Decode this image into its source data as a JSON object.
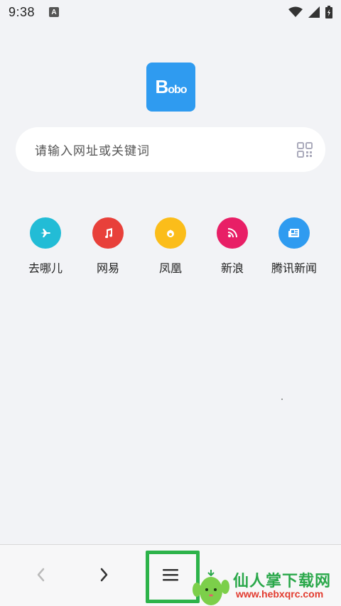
{
  "status_bar": {
    "time": "9:38",
    "notification_icon": "a-icon",
    "wifi_icon": "wifi-icon",
    "signal_icon": "signal-icon",
    "battery_icon": "battery-charging-icon"
  },
  "logo": {
    "text_main": "B",
    "text_rest": "obo",
    "color": "#2f9bf0"
  },
  "search": {
    "placeholder": "请输入网址或关键词",
    "scan_icon": "qr-scan-icon"
  },
  "shortcuts": [
    {
      "label": "去哪儿",
      "icon": "airplane-icon",
      "color": "#22bcd6"
    },
    {
      "label": "网易",
      "icon": "music-note-icon",
      "color": "#e8403a"
    },
    {
      "label": "凤凰",
      "icon": "flame-icon",
      "color": "#fbbd1a"
    },
    {
      "label": "新浪",
      "icon": "rss-icon",
      "color": "#e81f66"
    },
    {
      "label": "腾讯新闻",
      "icon": "newspaper-icon",
      "color": "#2f9bf0"
    }
  ],
  "bottom_bar": {
    "back_icon": "chevron-left-icon",
    "forward_icon": "chevron-right-icon",
    "menu_icon": "menu-icon",
    "highlight_color": "#2db34a"
  },
  "watermark": {
    "title": "仙人掌下载网",
    "url": "www.hebxqrc.com"
  }
}
